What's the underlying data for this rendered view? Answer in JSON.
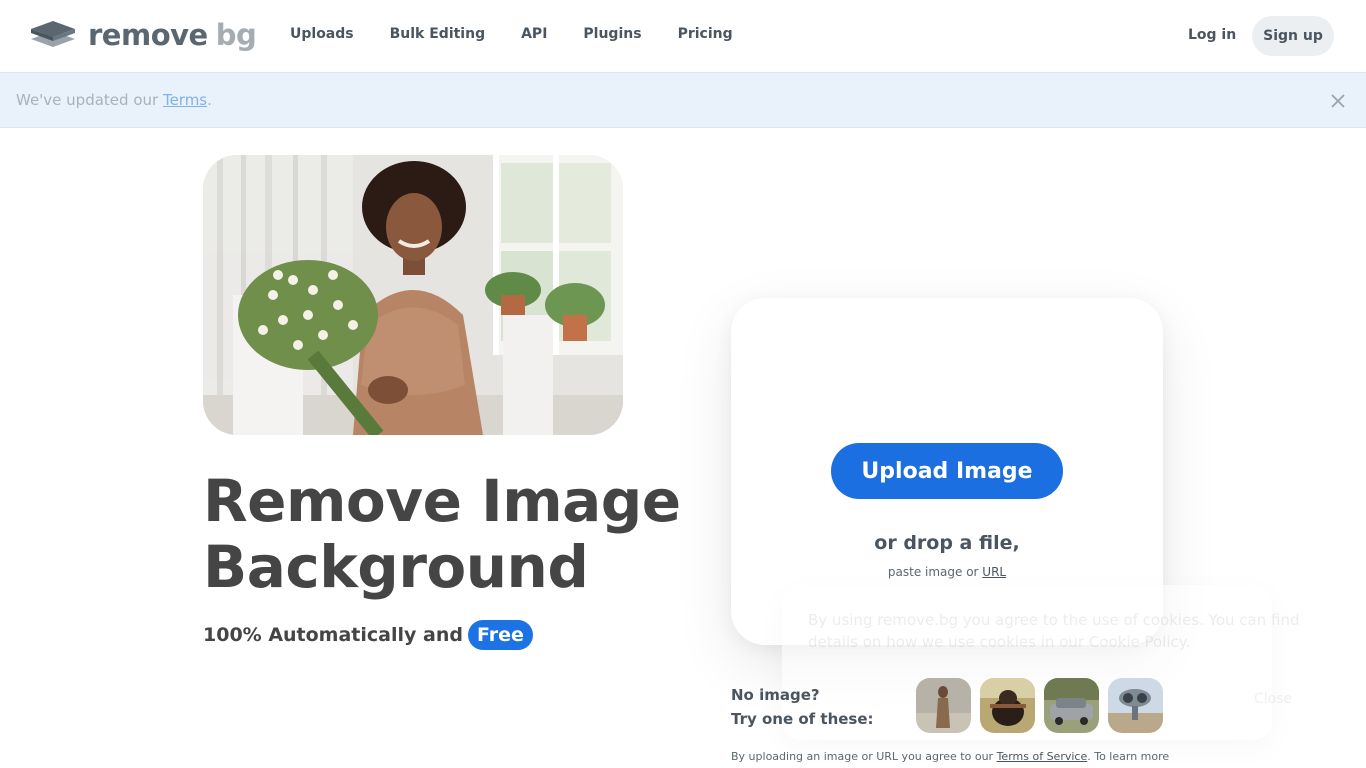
{
  "header": {
    "logo_main": "remove",
    "logo_accent": "bg",
    "nav": [
      "Uploads",
      "Bulk Editing",
      "API",
      "Plugins",
      "Pricing"
    ],
    "login": "Log in",
    "signup": "Sign up"
  },
  "banner": {
    "text_before": "We've updated our ",
    "link": "Terms",
    "text_after": "."
  },
  "hero": {
    "title_line1": "Remove Image",
    "title_line2": "Background",
    "subtitle": "100% Automatically and",
    "free_badge": "Free"
  },
  "upload": {
    "button": "Upload Image",
    "drop": "or drop a file,",
    "paste_prefix": "paste image or ",
    "paste_link": "URL"
  },
  "cookie": {
    "text": "By using remove.bg you agree to the use of cookies. You can find details on how we use cookies in our Cookie Policy.",
    "close": "Close"
  },
  "samples": {
    "line1": "No image?",
    "line2": "Try one of these:"
  },
  "terms": {
    "prefix": "By uploading an image or URL you agree to our ",
    "link": "Terms of Service",
    "suffix": ". To learn more"
  },
  "colors": {
    "primary": "#1c6fe0",
    "text": "#454545",
    "banner_bg": "#e9f1fb"
  }
}
